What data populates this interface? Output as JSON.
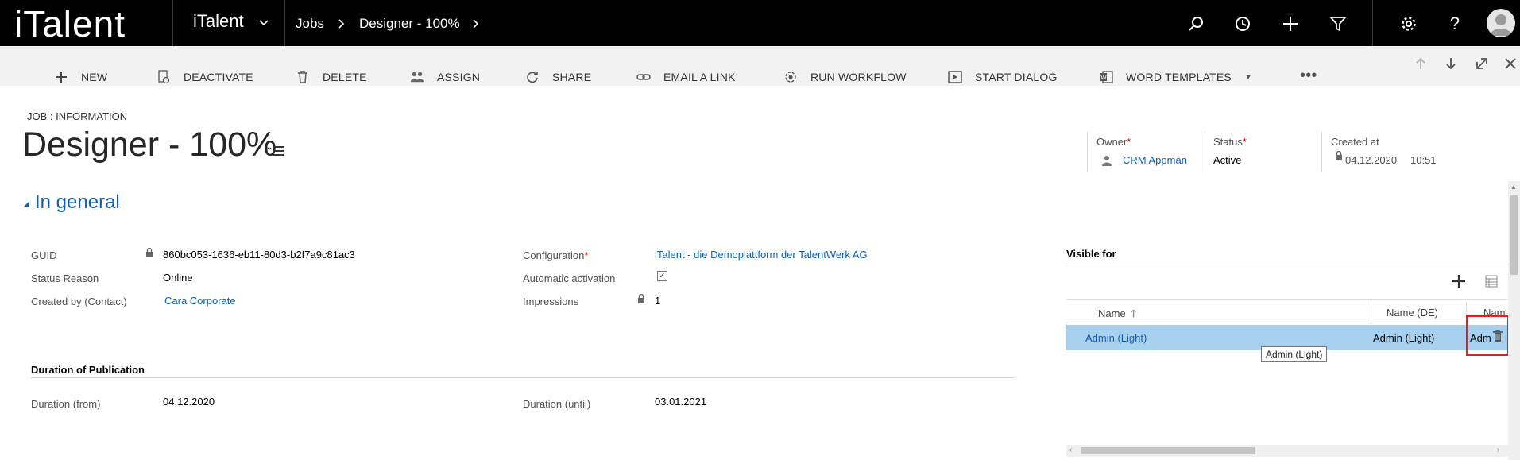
{
  "nav": {
    "logo": "iTalent",
    "app_title": "iTalent",
    "breadcrumb": [
      "Jobs",
      "Designer - 100%"
    ]
  },
  "commands": [
    {
      "label": "NEW",
      "icon": "plus-icon"
    },
    {
      "label": "DEACTIVATE",
      "icon": "deactivate-icon"
    },
    {
      "label": "DELETE",
      "icon": "trash-icon"
    },
    {
      "label": "ASSIGN",
      "icon": "assign-users-icon"
    },
    {
      "label": "SHARE",
      "icon": "share-icon"
    },
    {
      "label": "EMAIL A LINK",
      "icon": "link-icon"
    },
    {
      "label": "RUN WORKFLOW",
      "icon": "workflow-icon"
    },
    {
      "label": "START DIALOG",
      "icon": "dialog-icon"
    },
    {
      "label": "WORD TEMPLATES",
      "icon": "word-icon"
    }
  ],
  "header": {
    "entity_label": "JOB : INFORMATION",
    "title": "Designer - 100%",
    "owner_label": "Owner",
    "owner_value": "CRM Appman",
    "status_label": "Status",
    "status_value": "Active",
    "created_label": "Created at",
    "created_date": "04.12.2020",
    "created_time": "10:51"
  },
  "section_general": {
    "title": "In general",
    "guid_label": "GUID",
    "guid_value": "860bc053-1636-eb11-80d3-b2f7a9c81ac3",
    "status_reason_label": "Status Reason",
    "status_reason_value": "Online",
    "created_by_label": "Created by (Contact)",
    "created_by_value": "Cara Corporate",
    "configuration_label": "Configuration",
    "configuration_value": "iTalent - die Demoplattform der TalentWerk AG",
    "auto_activation_label": "Automatic activation",
    "auto_activation_checked": true,
    "impressions_label": "Impressions",
    "impressions_value": "1"
  },
  "section_publication": {
    "title": "Duration of Publication",
    "from_label": "Duration (from)",
    "from_value": "04.12.2020",
    "until_label": "Duration (until)",
    "until_value": "03.01.2021"
  },
  "visible_for": {
    "title": "Visible for",
    "columns": [
      "Name",
      "Name (DE)",
      "Nam"
    ],
    "rows": [
      {
        "name": "Admin (Light)",
        "name_de": "Admin (Light)",
        "name3": "Adm"
      }
    ],
    "tooltip": "Admin (Light)"
  },
  "colors": {
    "topbar": "#000000",
    "link": "#1160b7",
    "selected_row": "#a7d1ef",
    "highlight": "#e02020",
    "required": "#ee0000"
  }
}
